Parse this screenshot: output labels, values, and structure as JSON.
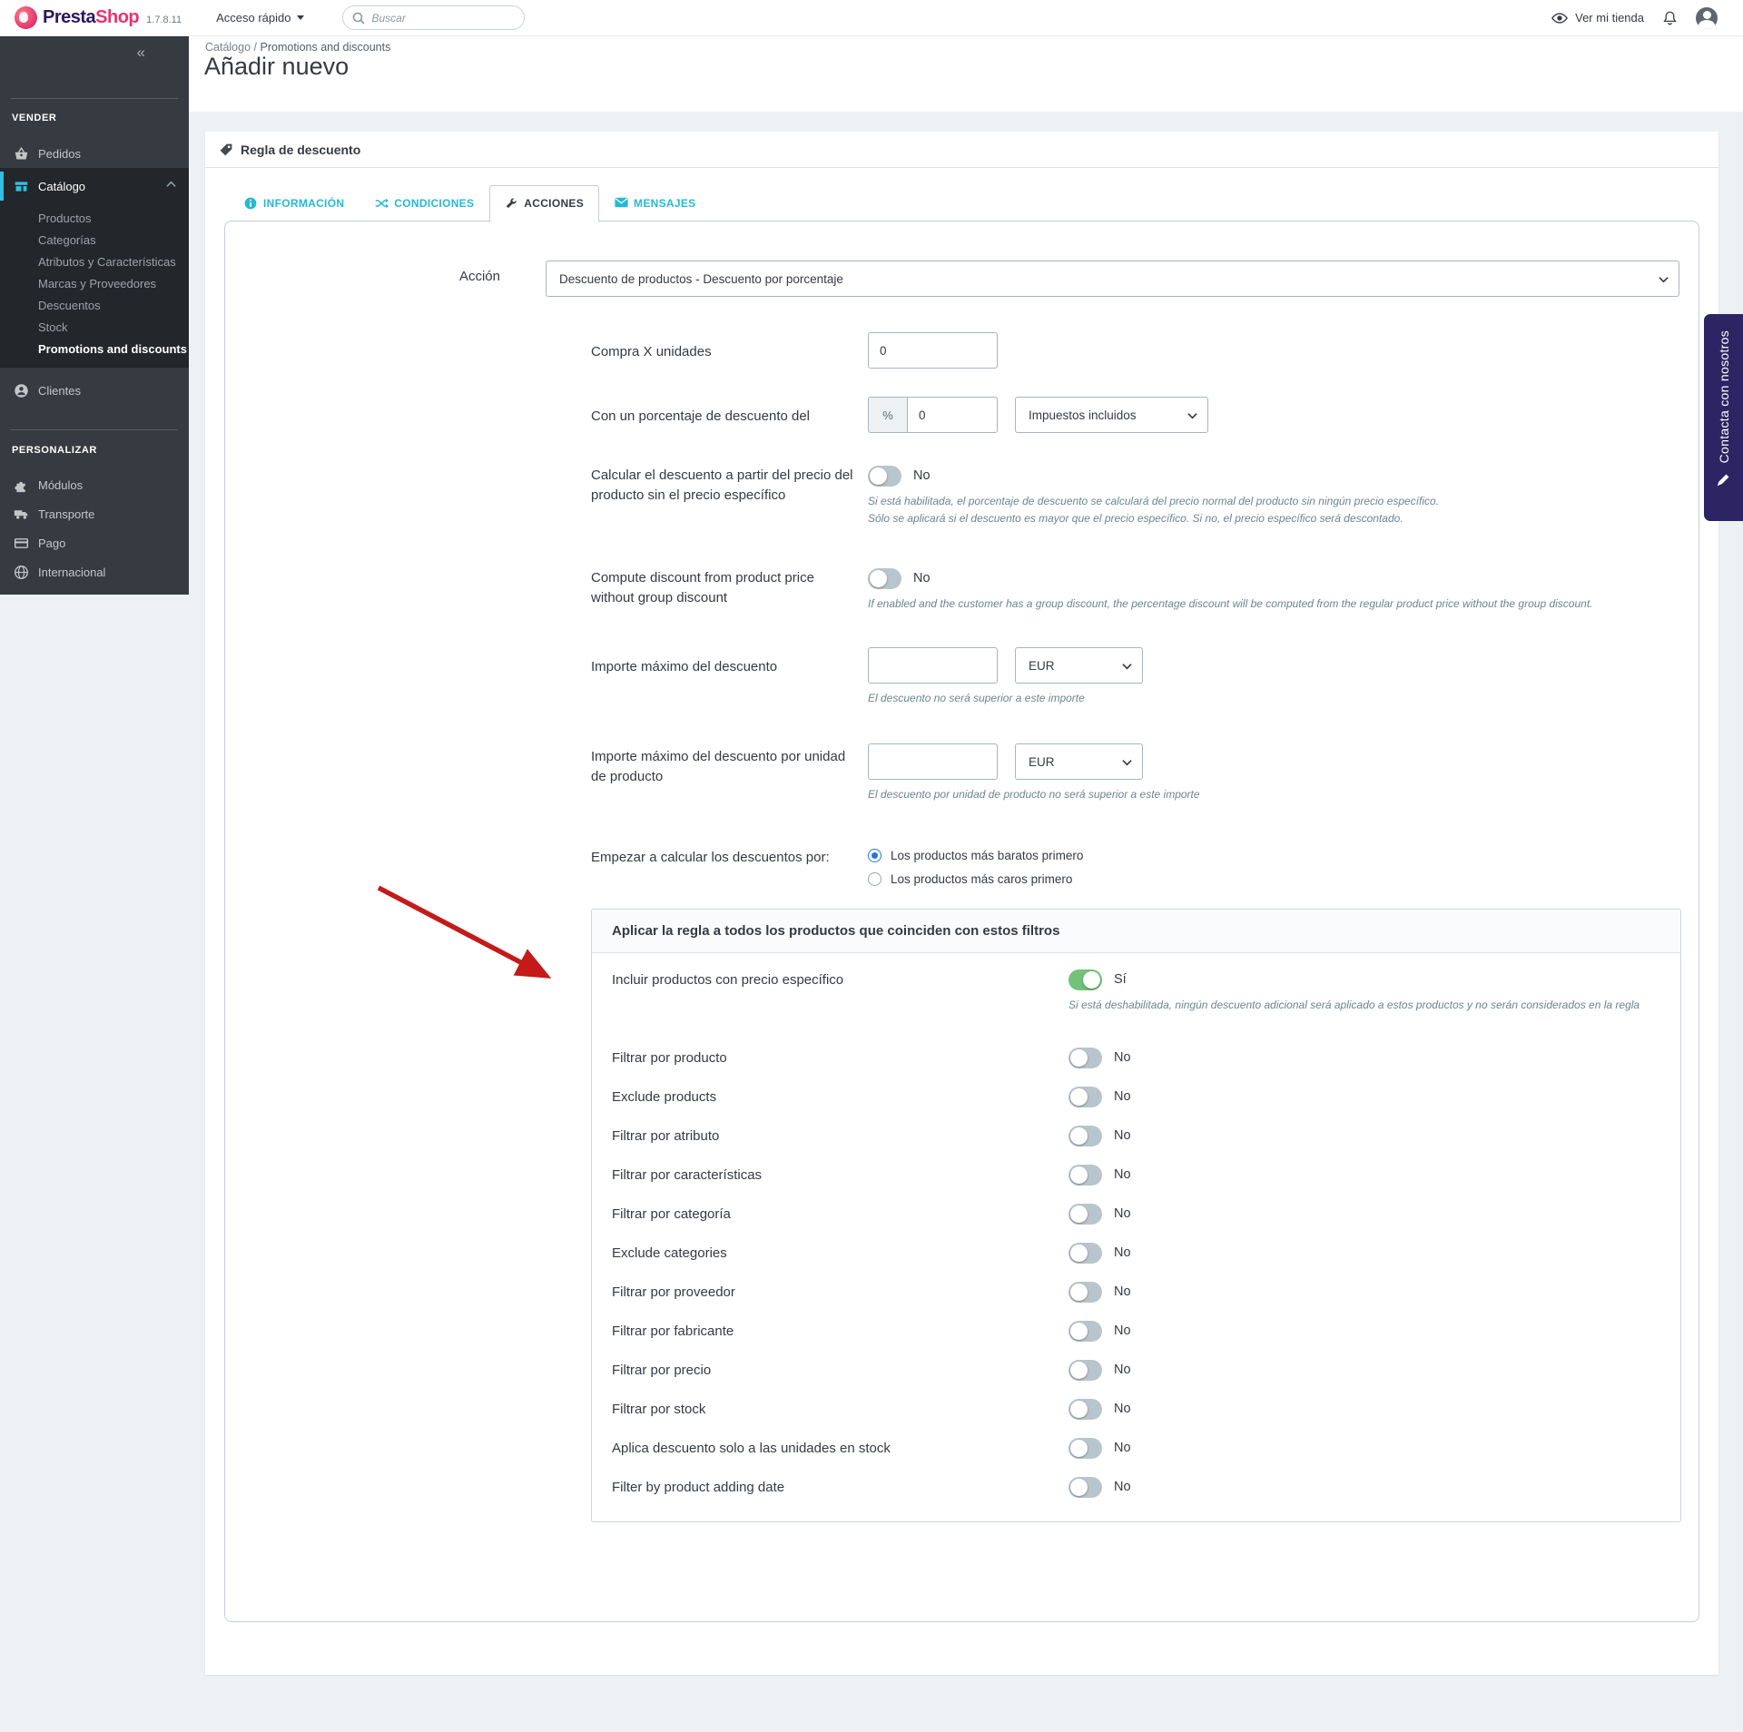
{
  "topbar": {
    "logo_presta": "Presta",
    "logo_shop": "Shop",
    "version": "1.7.8.11",
    "quick_access": "Acceso rápido",
    "search_placeholder": "Buscar",
    "view_shop": "Ver mi tienda"
  },
  "breadcrumb": {
    "parent": "Catálogo",
    "separator": "/",
    "current": "Promotions and discounts"
  },
  "page_title": "Añadir nuevo",
  "sidebar": {
    "collapse_icon": "«",
    "vender_header": "VENDER",
    "pedidos": "Pedidos",
    "catalogo": "Catálogo",
    "catalog_submenu": [
      "Productos",
      "Categorías",
      "Atributos y Características",
      "Marcas y Proveedores",
      "Descuentos",
      "Stock",
      "Promotions and discounts"
    ],
    "clientes": "Clientes",
    "personalizar_header": "PERSONALIZAR",
    "modulos": "Módulos",
    "transporte": "Transporte",
    "pago": "Pago",
    "internacional": "Internacional"
  },
  "panel": {
    "title": "Regla de descuento"
  },
  "tabs": [
    {
      "label": "INFORMACIÓN"
    },
    {
      "label": "CONDICIONES"
    },
    {
      "label": "ACCIONES"
    },
    {
      "label": "MENSAJES"
    }
  ],
  "form": {
    "accion_label": "Acción",
    "accion_value": "Descuento de productos - Descuento por porcentaje",
    "compra_label": "Compra X unidades",
    "compra_value": "0",
    "porcentaje_label": "Con un porcentaje de descuento del",
    "porcentaje_prefix": "%",
    "porcentaje_value": "0",
    "impuestos_value": "Impuestos incluidos",
    "calcular_label": "Calcular el descuento a partir del precio del producto sin el precio específico",
    "calcular_toggle": "No",
    "calcular_help_1": "Si está habilitada, el porcentaje de descuento se calculará del precio normal del producto sin ningún precio específico.",
    "calcular_help_2": "Sólo se aplicará si el descuento es mayor que el precio específico. Si no, el precio específico será descontado.",
    "compute_label": "Compute discount from product price without group discount",
    "compute_toggle": "No",
    "compute_help": "If enabled and the customer has a group discount, the percentage discount will be computed from the regular product price without the group discount.",
    "importe_label": "Importe máximo del descuento",
    "importe_currency": "EUR",
    "importe_help": "El descuento no será superior a este importe",
    "importe_unidad_label": "Importe máximo del descuento por unidad de producto",
    "importe_unidad_currency": "EUR",
    "importe_unidad_help": "El descuento por unidad de producto no será superior a este importe",
    "empezar_label": "Empezar a calcular los descuentos por:",
    "radio_1": "Los productos más baratos primero",
    "radio_2": "Los productos más caros primero"
  },
  "filters": {
    "title": "Aplicar la regla a todos los productos que coinciden con estos filtros",
    "incluir_label": "Incluir productos con precio específico",
    "incluir_state": "Sí",
    "incluir_help": "Si está deshabilitada, ningún descuento adicional será aplicado a estos productos y no serán considerados en la regla",
    "rows": [
      {
        "label": "Filtrar por producto",
        "state": "No"
      },
      {
        "label": "Exclude products",
        "state": "No"
      },
      {
        "label": "Filtrar por atributo",
        "state": "No"
      },
      {
        "label": "Filtrar por características",
        "state": "No"
      },
      {
        "label": "Filtrar por categoría",
        "state": "No"
      },
      {
        "label": "Exclude categories",
        "state": "No"
      },
      {
        "label": "Filtrar por proveedor",
        "state": "No"
      },
      {
        "label": "Filtrar por fabricante",
        "state": "No"
      },
      {
        "label": "Filtrar por precio",
        "state": "No"
      },
      {
        "label": "Filtrar por stock",
        "state": "No"
      },
      {
        "label": "Aplica descuento solo a las unidades en stock",
        "state": "No"
      },
      {
        "label": "Filter by product adding date",
        "state": "No"
      }
    ]
  },
  "contact_tab": "Contacta con nosotros",
  "colors": {
    "accent": "#25b9d7",
    "success": "#72c279",
    "arrow_red": "#c41a1a",
    "sidebar_bg": "#363a41",
    "submenu_bg": "#23262b",
    "contact_bg": "#2c2463"
  }
}
